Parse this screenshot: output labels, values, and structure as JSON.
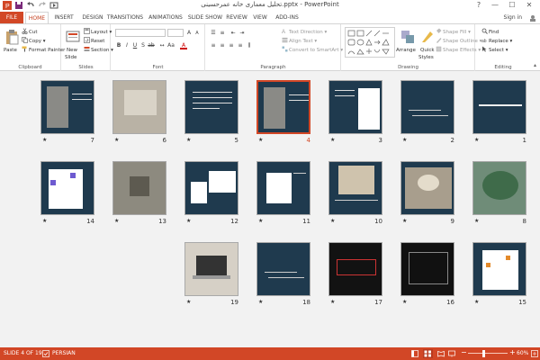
{
  "window": {
    "title": "تحلیل معماری خانه عمرحسینی.pptx - PowerPoint",
    "help": "?",
    "minimize": "—",
    "maximize": "☐",
    "close": "✕"
  },
  "tabs": [
    "FILE",
    "HOME",
    "INSERT",
    "DESIGN",
    "TRANSITIONS",
    "ANIMATIONS",
    "SLIDE SHOW",
    "REVIEW",
    "VIEW",
    "ADD-INS"
  ],
  "active_tab": "HOME",
  "sign_in": "Sign in",
  "ribbon": {
    "clipboard": {
      "label": "Clipboard",
      "paste": "Paste",
      "cut": "Cut",
      "copy": "Copy",
      "format_painter": "Format Painter"
    },
    "slides": {
      "label": "Slides",
      "new_slide": "New",
      "new_slide_2": "Slide",
      "layout": "Layout",
      "reset": "Reset",
      "section": "Section"
    },
    "font": {
      "label": "Font"
    },
    "paragraph": {
      "label": "Paragraph",
      "text_direction": "Text Direction",
      "align_text": "Align Text",
      "convert": "Convert to SmartArt"
    },
    "drawing": {
      "label": "Drawing",
      "arrange": "Arrange",
      "quick_styles": "Quick",
      "quick_styles_2": "Styles",
      "shape_fill": "Shape Fill",
      "shape_outline": "Shape Outline",
      "shape_effects": "Shape Effects"
    },
    "editing": {
      "label": "Editing",
      "find": "Find",
      "replace": "Replace",
      "select": "Select"
    }
  },
  "slides": [
    {
      "n": "1",
      "kind": "title",
      "star": "★"
    },
    {
      "n": "2",
      "kind": "text-dark",
      "star": "★"
    },
    {
      "n": "3",
      "kind": "text-map",
      "star": "★"
    },
    {
      "n": "4",
      "kind": "photo-text",
      "star": "★"
    },
    {
      "n": "5",
      "kind": "text-lines",
      "star": "★"
    },
    {
      "n": "6",
      "kind": "photo-building",
      "star": "★"
    },
    {
      "n": "7",
      "kind": "photo-text",
      "star": "★"
    },
    {
      "n": "8",
      "kind": "photo-tree",
      "star": "★"
    },
    {
      "n": "9",
      "kind": "photo-arch",
      "star": "★"
    },
    {
      "n": "10",
      "kind": "photo-facade",
      "star": "★"
    },
    {
      "n": "11",
      "kind": "plan-white",
      "star": "★"
    },
    {
      "n": "12",
      "kind": "plans-multi",
      "star": "★"
    },
    {
      "n": "13",
      "kind": "aerial",
      "star": "★"
    },
    {
      "n": "14",
      "kind": "plan-purple",
      "star": "★"
    },
    {
      "n": "15",
      "kind": "plan-orange",
      "star": "★"
    },
    {
      "n": "16",
      "kind": "plan-black",
      "star": "★"
    },
    {
      "n": "17",
      "kind": "plan-red",
      "star": "★"
    },
    {
      "n": "18",
      "kind": "text-dark",
      "star": "★"
    },
    {
      "n": "19",
      "kind": "photo-laptop",
      "star": "★"
    }
  ],
  "status": {
    "slide": "SLIDE 4 OF 19",
    "language": "PERSIAN",
    "zoom": "60%"
  },
  "colors": {
    "accent": "#d24726",
    "slide_bg": "#1f3a4e"
  }
}
